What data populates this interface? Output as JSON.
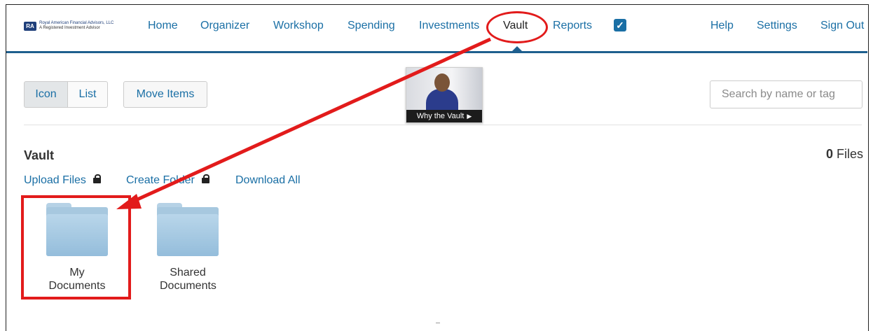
{
  "brand": {
    "logo_mark": "RA",
    "name_line1": "Royal American Financial Advisors, LLC",
    "name_line2": "A Registered Investment Advisor"
  },
  "nav": {
    "items": [
      {
        "label": "Home"
      },
      {
        "label": "Organizer"
      },
      {
        "label": "Workshop"
      },
      {
        "label": "Spending"
      },
      {
        "label": "Investments"
      },
      {
        "label": "Vault"
      },
      {
        "label": "Reports"
      }
    ],
    "right": [
      {
        "label": "Help"
      },
      {
        "label": "Settings"
      },
      {
        "label": "Sign Out"
      }
    ],
    "active": "Vault"
  },
  "toolbar": {
    "view_icon": "Icon",
    "view_list": "List",
    "move_items": "Move Items",
    "video_caption": "Why the Vault",
    "search_placeholder": "Search by name or tag"
  },
  "vault": {
    "title": "Vault",
    "files_count": "0",
    "files_label": "Files",
    "actions": {
      "upload": "Upload Files",
      "create_folder": "Create Folder",
      "download_all": "Download All"
    },
    "folders": [
      {
        "label": "My Documents"
      },
      {
        "label": "Shared Documents"
      }
    ]
  },
  "colors": {
    "link": "#1a6fa5",
    "nav_bar": "#1e5f8e",
    "annotation": "#e21b1b",
    "folder": "#a7c8df"
  }
}
